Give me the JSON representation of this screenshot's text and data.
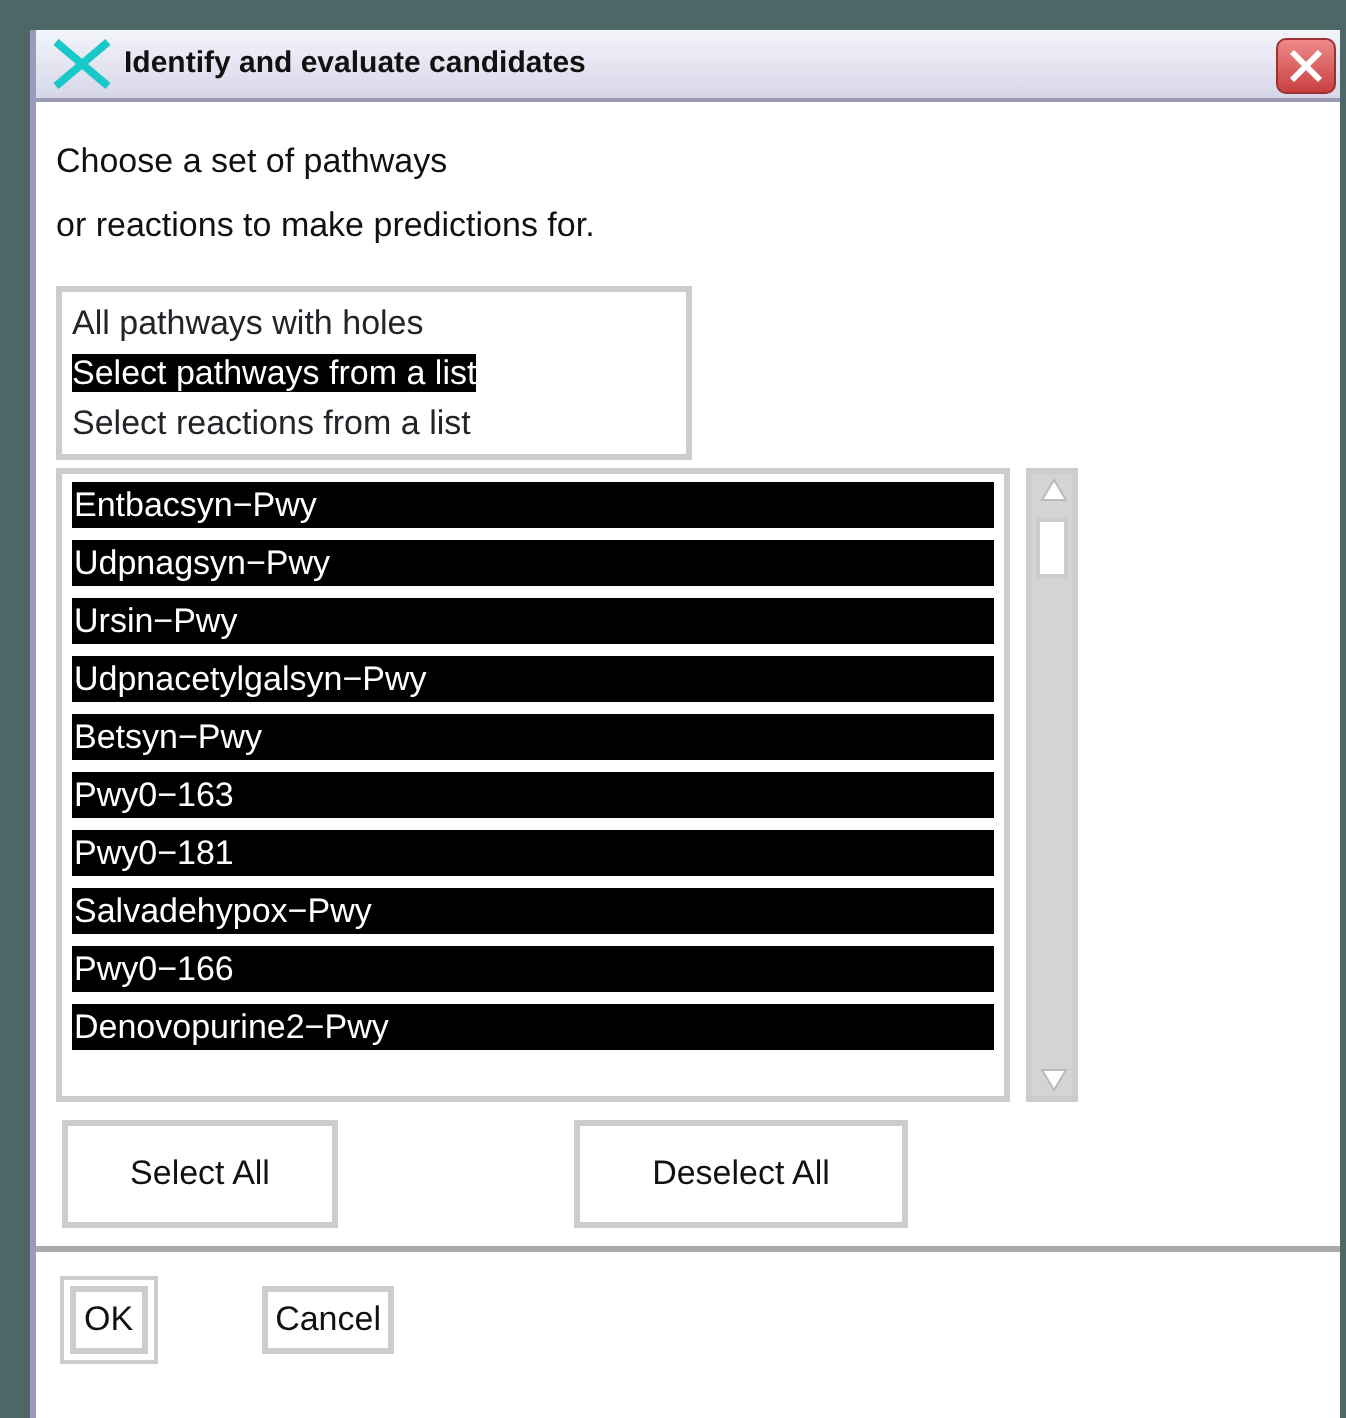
{
  "window": {
    "title": "Identify and evaluate candidates"
  },
  "prompt": [
    "Choose a set of pathways",
    "or reactions to make predictions for."
  ],
  "modes": [
    {
      "label": "All pathways with holes",
      "selected": false
    },
    {
      "label": "Select pathways from a list",
      "selected": true
    },
    {
      "label": "Select reactions from a list",
      "selected": false
    }
  ],
  "pathways": [
    {
      "label": "Entbacsyn−Pwy",
      "selected": true
    },
    {
      "label": "Udpnagsyn−Pwy",
      "selected": true
    },
    {
      "label": "Ursin−Pwy",
      "selected": true
    },
    {
      "label": "Udpnacetylgalsyn−Pwy",
      "selected": true
    },
    {
      "label": "Betsyn−Pwy",
      "selected": true
    },
    {
      "label": "Pwy0−163",
      "selected": true
    },
    {
      "label": "Pwy0−181",
      "selected": true
    },
    {
      "label": "Salvadehypox−Pwy",
      "selected": true
    },
    {
      "label": "Pwy0−166",
      "selected": true
    },
    {
      "label": "Denovopurine2−Pwy",
      "selected": true
    }
  ],
  "list_buttons": [
    "Select All",
    "Deselect All"
  ],
  "dialog_buttons": [
    {
      "label": "OK",
      "default": true
    },
    {
      "label": "Cancel",
      "default": false
    }
  ]
}
